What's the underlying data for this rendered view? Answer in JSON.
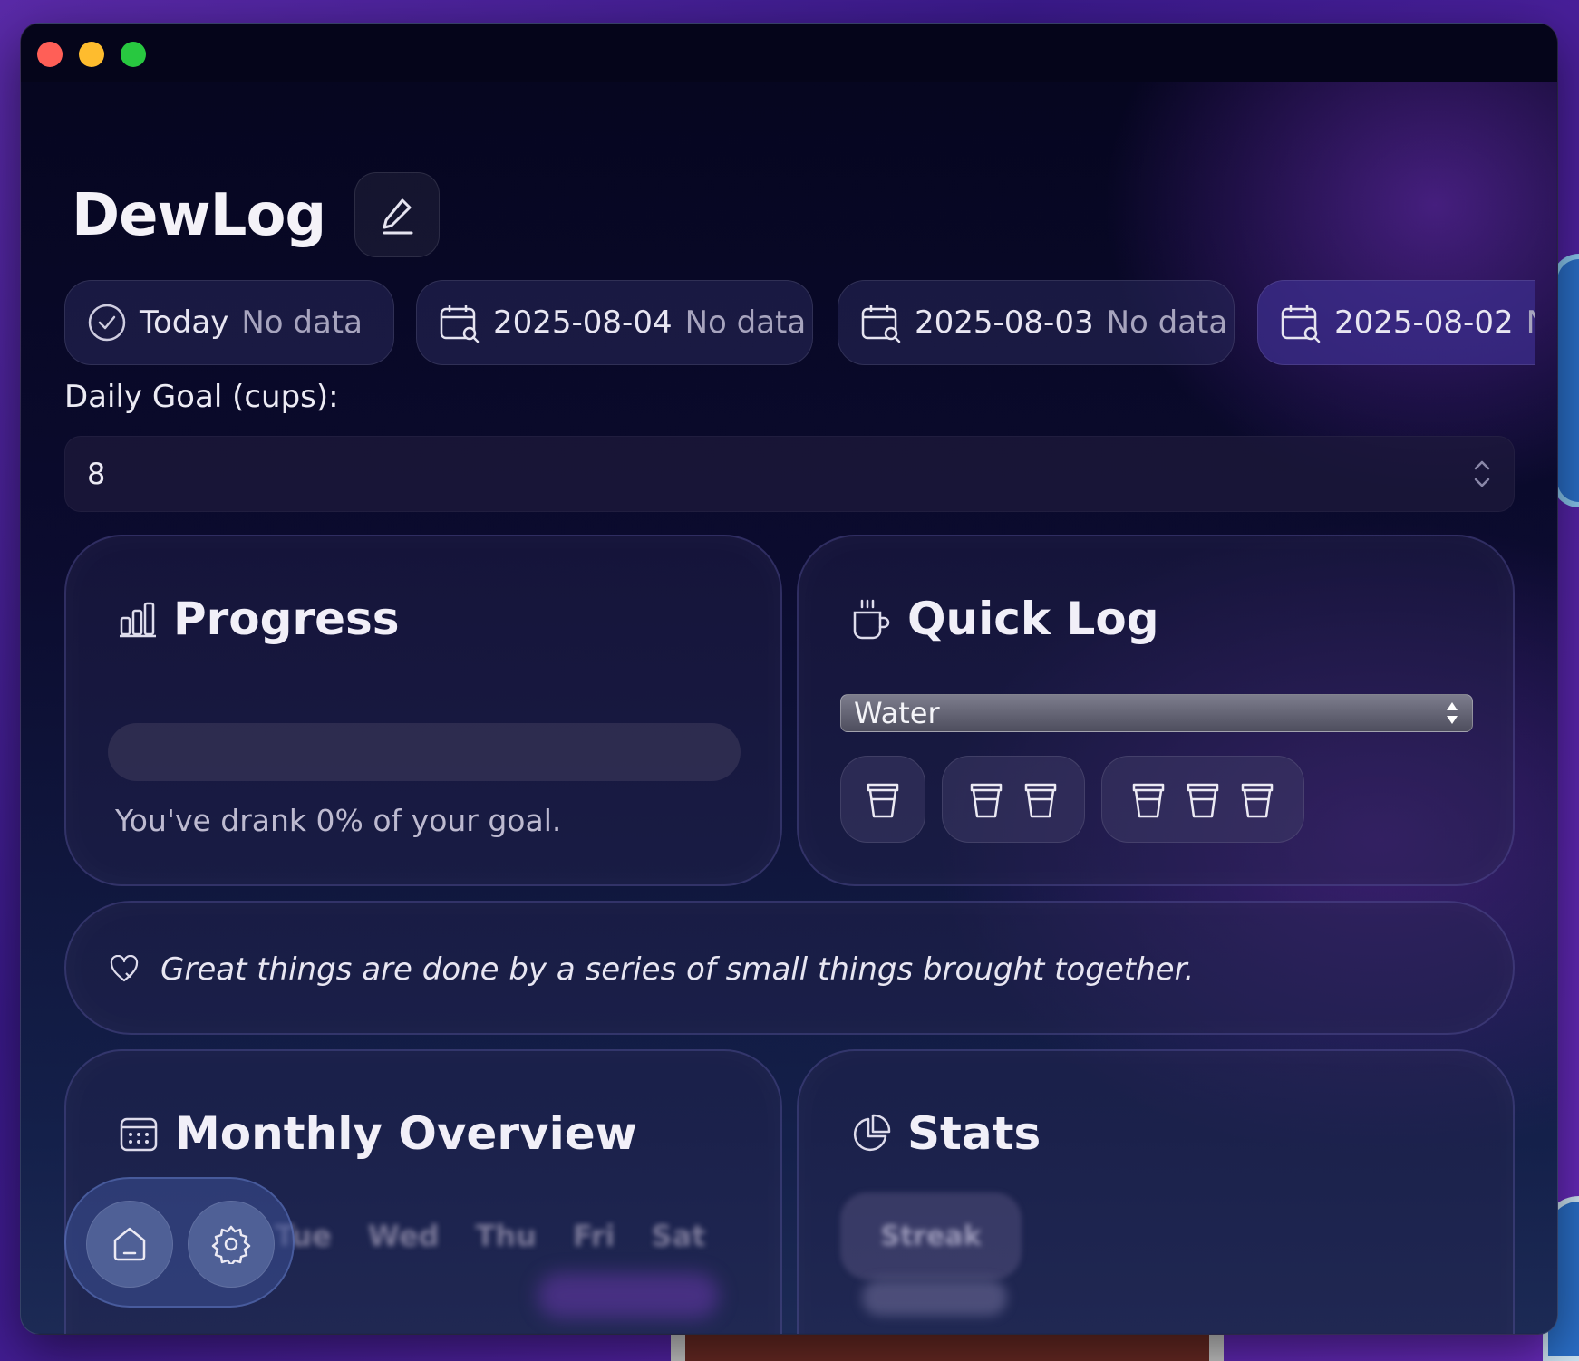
{
  "app": {
    "title": "DewLog"
  },
  "days": [
    {
      "label": "Today",
      "status": "No data",
      "icon": "check-circle-icon"
    },
    {
      "label": "2025-08-04",
      "status": "No data",
      "icon": "calendar-search-icon"
    },
    {
      "label": "2025-08-03",
      "status": "No data",
      "icon": "calendar-search-icon"
    },
    {
      "label": "2025-08-02",
      "status": "No data",
      "icon": "calendar-search-icon"
    }
  ],
  "goal": {
    "label": "Daily Goal (cups):",
    "value": "8"
  },
  "progress": {
    "title": "Progress",
    "percent": 0,
    "text": "You've drank 0% of your goal."
  },
  "quicklog": {
    "title": "Quick Log",
    "drink": "Water",
    "cup_options": [
      1,
      2,
      3
    ]
  },
  "quote": {
    "text": "Great things are done by a series of small things brought together."
  },
  "monthly": {
    "title": "Monthly Overview",
    "weekdays": [
      "Tue",
      "Wed",
      "Thu",
      "Fri",
      "Sat"
    ]
  },
  "stats": {
    "title": "Stats",
    "pill_label": "Streak"
  },
  "colors": {
    "accent": "#5aa8ff",
    "background": "#0b0b2e"
  }
}
